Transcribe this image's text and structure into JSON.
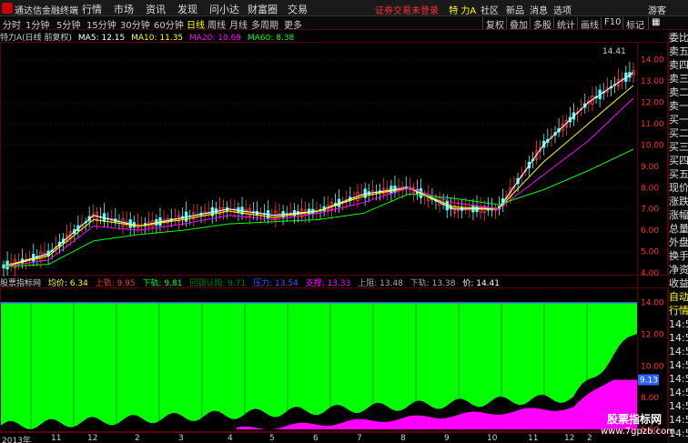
{
  "app": {
    "title": "通达信金融终端",
    "menu": [
      "行情",
      "市场",
      "资讯",
      "发现",
      "问小达",
      "财富圈",
      "交易"
    ],
    "status_text": "证券交易未登录",
    "stock_title": "特 力A",
    "top_right": [
      "社区",
      "新品",
      "消息",
      "选项"
    ],
    "guest": "游客"
  },
  "periods": [
    "分时",
    "1分钟",
    "5分钟",
    "15分钟",
    "30分钟",
    "60分钟",
    "日线",
    "周线",
    "月线",
    "多周期",
    "更多"
  ],
  "active_period": "日线",
  "tools": [
    "复权",
    "叠加",
    "多股",
    "统计",
    "画线",
    "F10",
    "标记"
  ],
  "ma_line": {
    "name": "特力A(日线 前复权)",
    "ma5": "MA5: 12.15",
    "ma10": "MA10: 11.35",
    "ma20": "MA20: 10.69",
    "ma60": "MA60: 8.38"
  },
  "price_axis": [
    "14.00",
    "13.00",
    "12.00",
    "11.00",
    "10.00",
    "9.00",
    "8.00",
    "7.00",
    "6.00",
    "5.00",
    "4.00"
  ],
  "max_label": "14.41",
  "indicator_bar": {
    "name": "股票指标网",
    "avg": "均价: 6.34",
    "upper": "上轨: 9.95",
    "lower": "下轨: 9.81",
    "pullback": "回调认购: 9.71",
    "pressure": "压力: 13.54",
    "support": "支撑: 13.33",
    "up_stop": "上阻: 13.48",
    "down_stop": "下轨: 13.38",
    "price": "价: 14.41"
  },
  "ind_axis": [
    "14.00",
    "12.00",
    "10.00",
    "8.00",
    "6.00"
  ],
  "ind_current": "9.13",
  "x_labels": [
    "2013年",
    "11",
    "12",
    "2",
    "3",
    "4",
    "5",
    "6",
    "7",
    "8",
    "9",
    "10",
    "11",
    "12",
    "2"
  ],
  "right_panel": [
    "委比",
    "卖五",
    "卖四",
    "卖三",
    "卖二",
    "卖一",
    "买一",
    "买二",
    "买三",
    "买四",
    "买五",
    "现价",
    "涨跌",
    "涨幅",
    "总量",
    "外盘",
    "换手",
    "净资",
    "收益",
    "自动",
    "行情",
    "14:56",
    "14:56",
    "14:56",
    "14:56",
    "14:56",
    "14:56",
    "14:56",
    "14:56",
    "14:56"
  ],
  "watermark": {
    "line1": "股票指标网",
    "line2": "www.7gpzb.com"
  },
  "colors": {
    "ma5": "#ffffff",
    "ma10": "#ffff00",
    "ma20": "#ff00ff",
    "ma60": "#00ff00",
    "candle_up": "#ff3c3c",
    "candle_down": "#54ffff",
    "green_area": "#00ff00",
    "magenta_area": "#ff00ff"
  },
  "chart_data": {
    "type": "line",
    "title": "特力A(日线 前复权)",
    "x": [
      "2013年",
      "11",
      "12",
      "2",
      "3",
      "4",
      "5",
      "6",
      "7",
      "8",
      "9",
      "10",
      "11",
      "12",
      "2"
    ],
    "series": [
      {
        "name": "MA5",
        "values": [
          4.3,
          4.9,
          6.7,
          6.2,
          6.6,
          7.0,
          6.7,
          6.9,
          7.7,
          8.0,
          7.0,
          7.0,
          10.0,
          12.0,
          13.4
        ]
      },
      {
        "name": "MA10",
        "values": [
          4.3,
          4.8,
          6.5,
          6.2,
          6.5,
          6.9,
          6.6,
          6.9,
          7.6,
          8.0,
          7.1,
          7.0,
          9.2,
          11.0,
          12.8
        ]
      },
      {
        "name": "MA20",
        "values": [
          4.3,
          4.6,
          6.2,
          6.0,
          6.3,
          6.7,
          6.5,
          6.8,
          7.3,
          8.0,
          7.3,
          7.0,
          8.6,
          10.2,
          12.2
        ]
      },
      {
        "name": "MA60",
        "values": [
          4.3,
          4.4,
          5.5,
          5.8,
          6.0,
          6.3,
          6.4,
          6.5,
          6.8,
          7.7,
          7.5,
          7.2,
          7.9,
          8.8,
          9.8
        ]
      }
    ],
    "ylim": [
      4.0,
      14.5
    ],
    "grid": true
  }
}
